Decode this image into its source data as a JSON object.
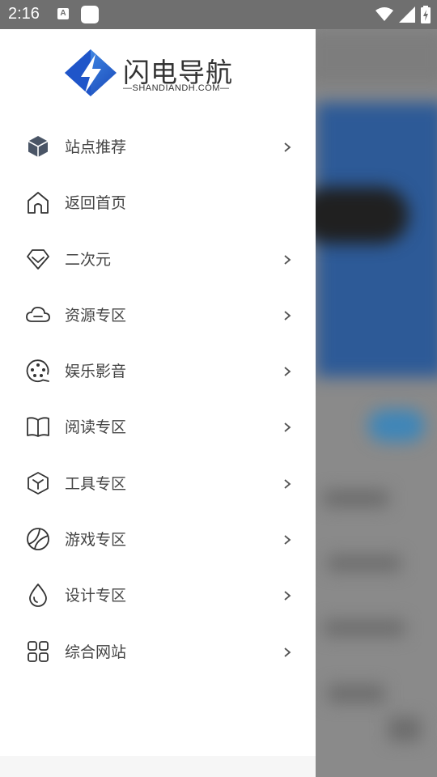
{
  "status_bar": {
    "time": "2:16",
    "notif_letter": "A"
  },
  "logo": {
    "title": "闪电导航",
    "subtitle": "—SHANDIANDH.COM—"
  },
  "menu": [
    {
      "label": "站点推荐",
      "icon": "cube-icon",
      "has_arrow": true
    },
    {
      "label": "返回首页",
      "icon": "home-icon",
      "has_arrow": false
    },
    {
      "label": "二次元",
      "icon": "diamond-icon",
      "has_arrow": true
    },
    {
      "label": "资源专区",
      "icon": "cloud-icon",
      "has_arrow": true
    },
    {
      "label": "娱乐影音",
      "icon": "film-reel-icon",
      "has_arrow": true
    },
    {
      "label": "阅读专区",
      "icon": "book-icon",
      "has_arrow": true
    },
    {
      "label": "工具专区",
      "icon": "box-icon",
      "has_arrow": true
    },
    {
      "label": "游戏专区",
      "icon": "ball-icon",
      "has_arrow": true
    },
    {
      "label": "设计专区",
      "icon": "drop-icon",
      "has_arrow": true
    },
    {
      "label": "综合网站",
      "icon": "grid-icon",
      "has_arrow": true
    }
  ],
  "colors": {
    "logo_blue": "#1f5fd1",
    "logo_light": "#4d9cf0",
    "text": "#444444",
    "scrim": "#8a8a8a"
  }
}
